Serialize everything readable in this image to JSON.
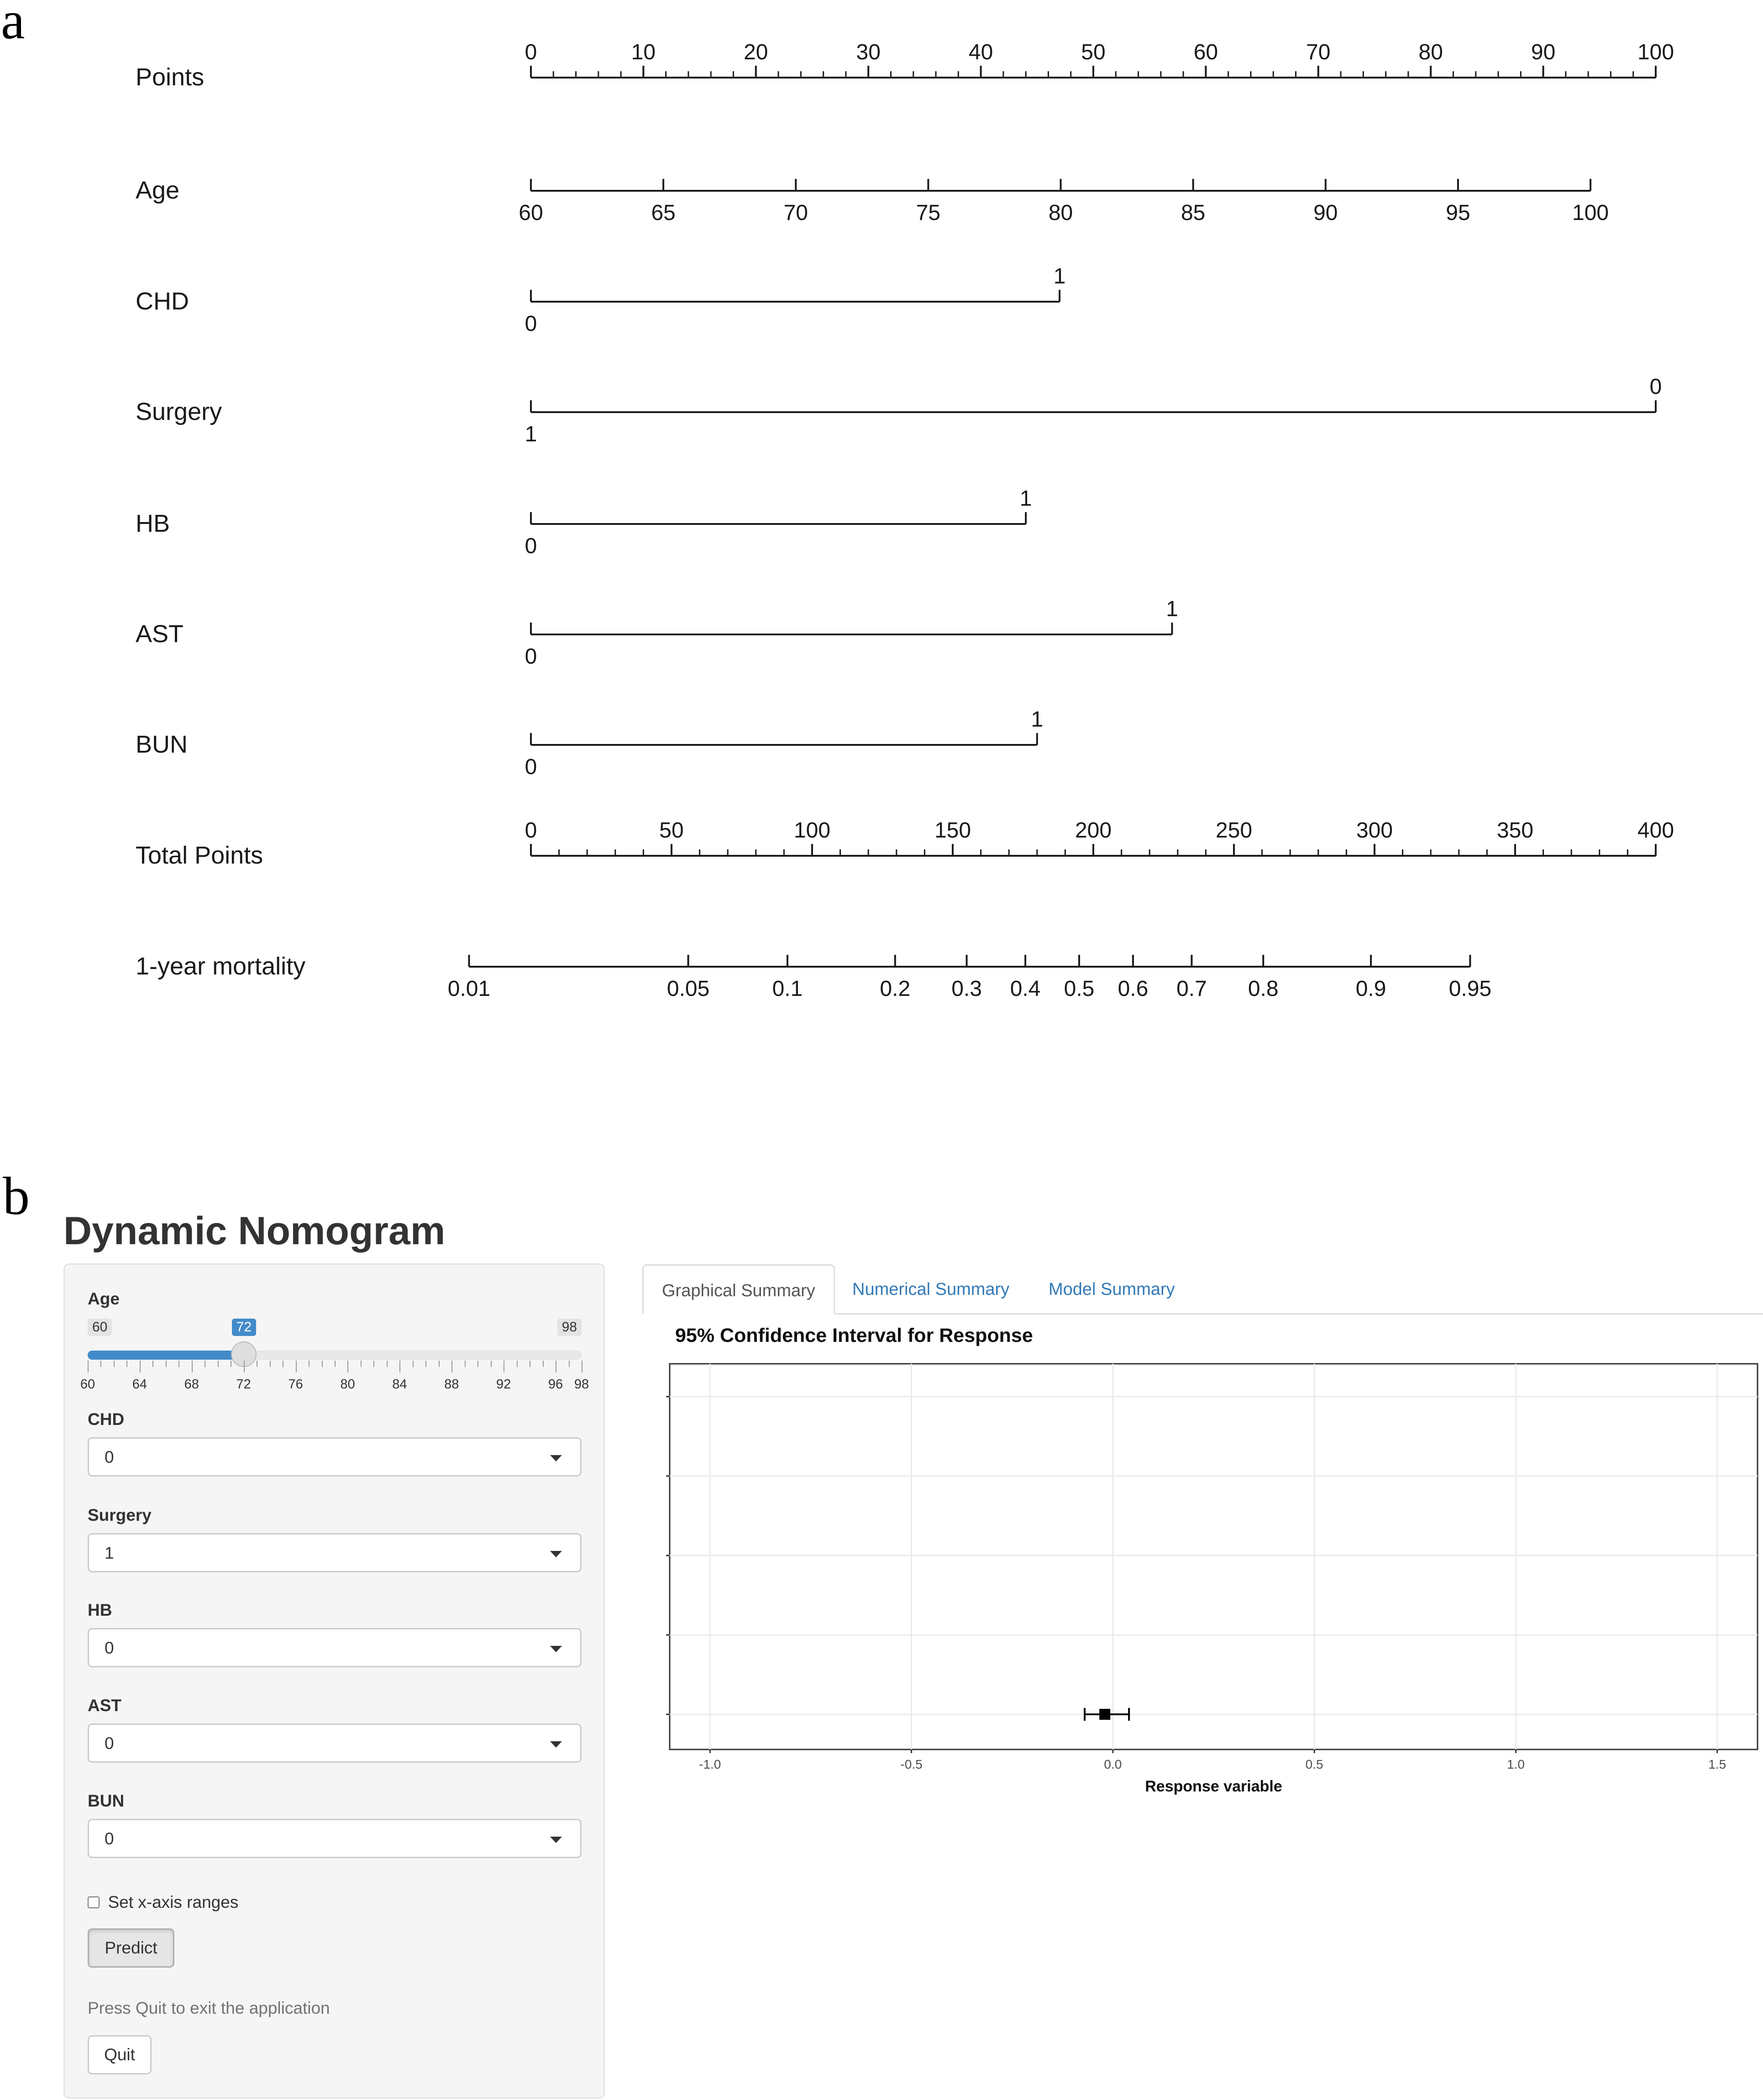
{
  "panel_labels": {
    "a": "a",
    "b": "b"
  },
  "chart_data": [
    {
      "type": "nomogram",
      "scales": [
        {
          "name": "Points",
          "kind": "axis",
          "ticks_above": true,
          "range": [
            0,
            100
          ],
          "minor_step": 2,
          "labels": [
            "0",
            "10",
            "20",
            "30",
            "40",
            "50",
            "60",
            "70",
            "80",
            "90",
            "100"
          ],
          "label_values": [
            0,
            10,
            20,
            30,
            40,
            50,
            60,
            70,
            80,
            90,
            100
          ]
        },
        {
          "name": "Age",
          "kind": "axis",
          "ticks_above": false,
          "range": [
            60,
            100
          ],
          "points_range": [
            0,
            94.2
          ],
          "labels": [
            "60",
            "65",
            "70",
            "75",
            "80",
            "85",
            "90",
            "95",
            "100"
          ],
          "label_values": [
            60,
            65,
            70,
            75,
            80,
            85,
            90,
            95,
            100
          ]
        },
        {
          "name": "CHD",
          "kind": "binary",
          "low_label": "0",
          "high_label": "1",
          "low_points": 0,
          "high_points": 47
        },
        {
          "name": "Surgery",
          "kind": "binary",
          "low_label": "1",
          "high_label": "0",
          "low_points": 0,
          "high_points": 100
        },
        {
          "name": "HB",
          "kind": "binary",
          "low_label": "0",
          "high_label": "1",
          "low_points": 0,
          "high_points": 44
        },
        {
          "name": "AST",
          "kind": "binary",
          "low_label": "0",
          "high_label": "1",
          "low_points": 0,
          "high_points": 57
        },
        {
          "name": "BUN",
          "kind": "binary",
          "low_label": "0",
          "high_label": "1",
          "low_points": 0,
          "high_points": 45
        },
        {
          "name": "Total Points",
          "kind": "axis",
          "ticks_above": true,
          "range": [
            0,
            400
          ],
          "minor_step": 10,
          "labels": [
            "0",
            "50",
            "100",
            "150",
            "200",
            "250",
            "300",
            "350",
            "400"
          ],
          "label_values": [
            0,
            50,
            100,
            150,
            200,
            250,
            300,
            350,
            400
          ]
        },
        {
          "name": "1-year mortality",
          "kind": "probability",
          "total_points_range": [
            -22,
            334
          ],
          "labels": [
            "0.01",
            "0.05",
            "0.1",
            "0.2",
            "0.3",
            "0.4",
            "0.5",
            "0.6",
            "0.7",
            "0.8",
            "0.9",
            "0.95"
          ],
          "label_values": [
            0.01,
            0.05,
            0.1,
            0.2,
            0.3,
            0.4,
            0.5,
            0.6,
            0.7,
            0.8,
            0.9,
            0.95
          ]
        }
      ]
    },
    {
      "type": "errorbar",
      "title": "95% Confidence Interval for Response",
      "xlabel": "Response variable",
      "xlim": [
        -1.1,
        1.6
      ],
      "x_ticks": [
        -1.0,
        -0.5,
        0.0,
        0.5,
        1.0,
        1.5
      ],
      "x_tick_labels": [
        "-1.0",
        "-0.5",
        "0.0",
        "0.5",
        "1.0",
        "1.5"
      ],
      "y_tick_count": 5,
      "grid": true,
      "point": {
        "estimate": -0.02,
        "lower": -0.07,
        "upper": 0.04,
        "row": 1
      }
    }
  ],
  "app": {
    "title": "Dynamic Nomogram",
    "age": {
      "label": "Age",
      "min": 60,
      "max": 98,
      "value": 72,
      "min_label": "60",
      "max_label": "98",
      "value_label": "72",
      "tick_labels": [
        "60",
        "64",
        "68",
        "72",
        "76",
        "80",
        "84",
        "88",
        "92",
        "96",
        "98"
      ],
      "tick_values": [
        60,
        64,
        68,
        72,
        76,
        80,
        84,
        88,
        92,
        96,
        98
      ]
    },
    "selects": [
      {
        "label": "CHD",
        "value": "0"
      },
      {
        "label": "Surgery",
        "value": "1"
      },
      {
        "label": "HB",
        "value": "0"
      },
      {
        "label": "AST",
        "value": "0"
      },
      {
        "label": "BUN",
        "value": "0"
      }
    ],
    "set_xaxis_label": "Set x-axis ranges",
    "predict_label": "Predict",
    "quit_help": "Press Quit to exit the application",
    "quit_label": "Quit",
    "tabs": [
      {
        "label": "Graphical Summary",
        "active": true
      },
      {
        "label": "Numerical Summary",
        "active": false
      },
      {
        "label": "Model Summary",
        "active": false
      }
    ],
    "accent_color": "#428bca",
    "link_color": "#337ab7"
  }
}
